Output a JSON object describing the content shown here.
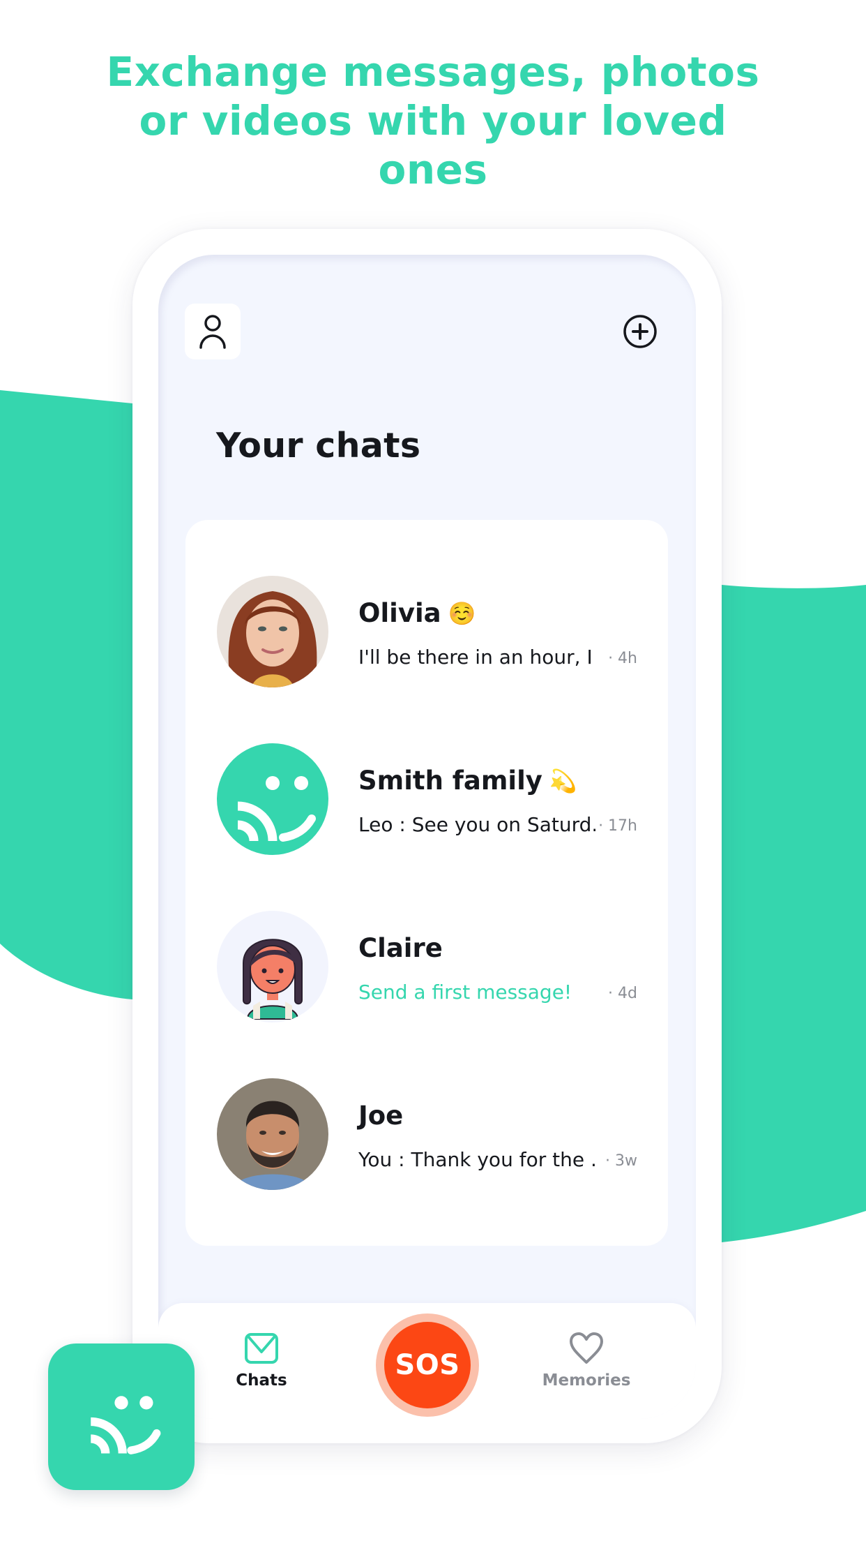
{
  "headline": {
    "lines": [
      "Exchange messages, photos",
      "or videos with your loved",
      "ones"
    ]
  },
  "colors": {
    "brand": "#35d6ae",
    "sos": "#fc4714",
    "sos_ring": "#fbc0ab",
    "text_dark": "#16181d",
    "text_muted": "#8a8d94",
    "screen_bg": "#f3f6fe"
  },
  "header": {
    "profile_icon": "person-icon",
    "add_icon": "plus-circle-icon"
  },
  "page_title": "Your chats",
  "chats": [
    {
      "name": "Olivia",
      "emoji": "☺️",
      "preview": "I'll be there in an hour, I ...",
      "time": "· 4h",
      "avatar": "photo-woman",
      "preview_accent": false
    },
    {
      "name": "Smith family",
      "emoji": "💫",
      "preview": "Leo : See you on Saturd...",
      "time": "· 17h",
      "avatar": "app-logo",
      "preview_accent": false
    },
    {
      "name": "Claire",
      "emoji": "",
      "preview": "Send a first message!",
      "time": "· 4d",
      "avatar": "cartoon-girl",
      "preview_accent": true
    },
    {
      "name": "Joe",
      "emoji": "",
      "preview": "You : Thank you for the ...",
      "time": "· 3w",
      "avatar": "photo-man",
      "preview_accent": false
    }
  ],
  "bottom_nav": {
    "chats_label": "Chats",
    "chats_icon": "envelope-icon",
    "sos_label": "SOS",
    "memories_label": "Memories",
    "memories_icon": "heart-icon",
    "active": "Chats"
  }
}
